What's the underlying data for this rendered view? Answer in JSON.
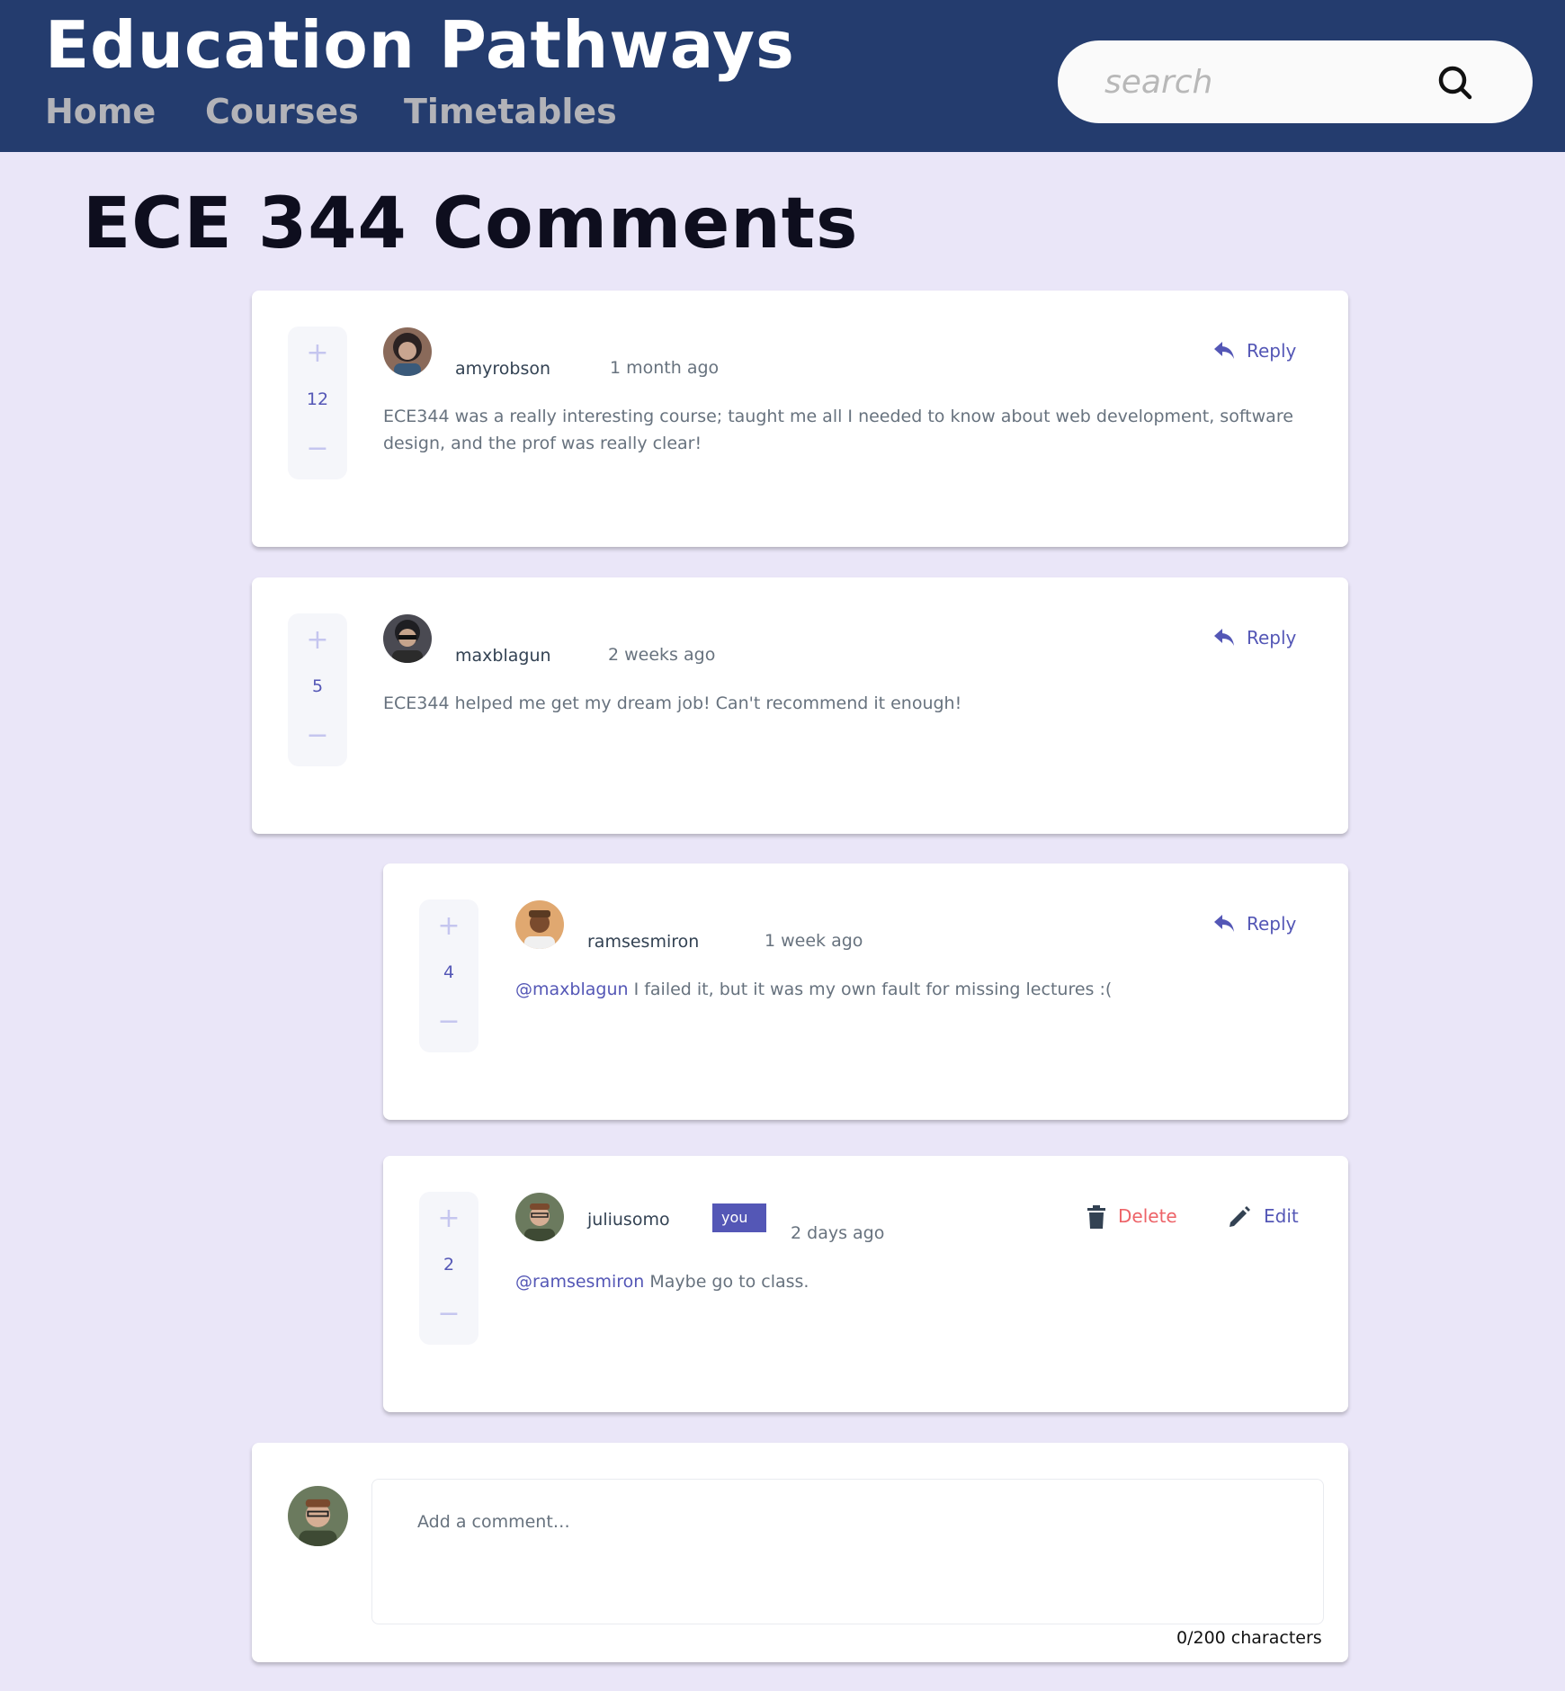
{
  "header": {
    "site_title": "Education Pathways",
    "nav": [
      "Home",
      "Courses",
      "Timetables"
    ],
    "search_placeholder": "search"
  },
  "page_title": "ECE 344 Comments",
  "comments": [
    {
      "username": "amyrobson",
      "time": "1 month ago",
      "score": "12",
      "text": "ECE344 was a really interesting course; taught me all I needed to know about web development, software design, and the prof was really clear!",
      "action": "Reply",
      "avatar_colors": [
        "#8a6a5a",
        "#2b2222",
        "#c9a590"
      ]
    },
    {
      "username": "maxblagun",
      "time": "2 weeks ago",
      "score": "5",
      "text": "ECE344 helped me get my dream job! Can't recommend it enough!",
      "action": "Reply",
      "avatar_colors": [
        "#4a4a52",
        "#1e1e22",
        "#c6a48c"
      ]
    },
    {
      "username": "ramsesmiron",
      "time": "1 week ago",
      "score": "4",
      "mention": "@maxblagun",
      "text": " I failed it, but it was my own fault for missing lectures :(",
      "action": "Reply",
      "avatar_colors": [
        "#e0a870",
        "#5a3a22",
        "#7a4b2e"
      ]
    },
    {
      "username": "juliusomo",
      "badge": "you",
      "time": "2 days ago",
      "score": "2",
      "mention": "@ramsesmiron",
      "text": " Maybe go to class.",
      "delete_label": "Delete",
      "edit_label": "Edit",
      "avatar_colors": [
        "#6b7a5e",
        "#3e4a34",
        "#d6ae94"
      ]
    }
  ],
  "new_comment": {
    "placeholder": "Add a comment…",
    "char_count": "0/200 characters"
  },
  "colors": {
    "header_bg": "#243c6e",
    "page_bg": "#eae6f8",
    "accent": "#5457b6",
    "danger": "#ed6368"
  },
  "icons": [
    "search-icon",
    "reply-icon",
    "delete-icon",
    "edit-icon",
    "plus-icon",
    "minus-icon"
  ]
}
